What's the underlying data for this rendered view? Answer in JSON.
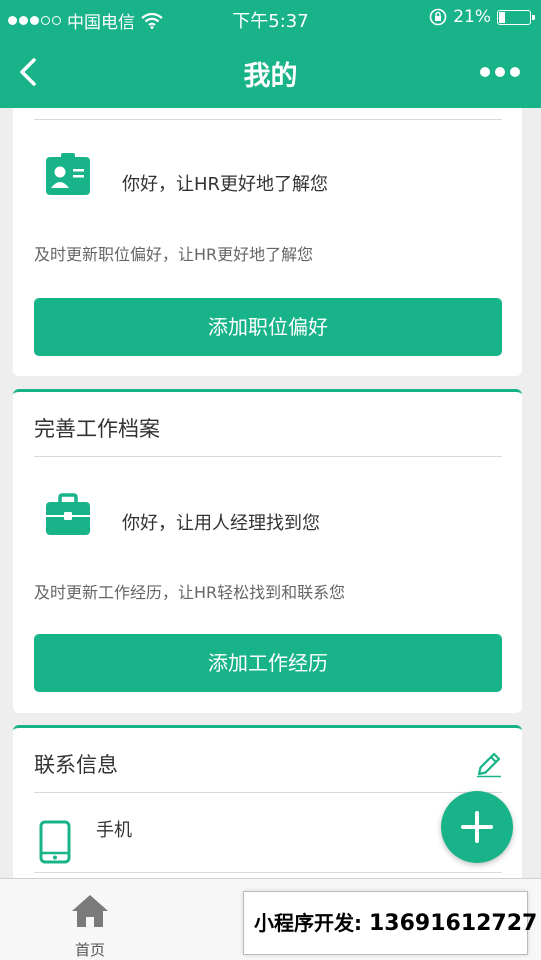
{
  "status_bar": {
    "carrier": "中国电信",
    "time": "下午5:37",
    "battery": "21%",
    "battery_level": 0.21
  },
  "nav": {
    "title": "我的"
  },
  "job_pref": {
    "row_text": "你好，让HR更好地了解您",
    "desc": "及时更新职位偏好，让HR更好地了解您",
    "button": "添加职位偏好"
  },
  "work_profile": {
    "title": "完善工作档案",
    "row_text": "你好，让用人经理找到您",
    "desc": "及时更新工作经历，让HR轻松找到和联系您",
    "button": "添加工作经历"
  },
  "contact": {
    "title": "联系信息",
    "phone_label": "手机"
  },
  "tabbar": {
    "home": "首页"
  },
  "promo": {
    "label": "小程序开发:",
    "phone": "13691612727"
  },
  "colors": {
    "accent": "#19b389"
  }
}
